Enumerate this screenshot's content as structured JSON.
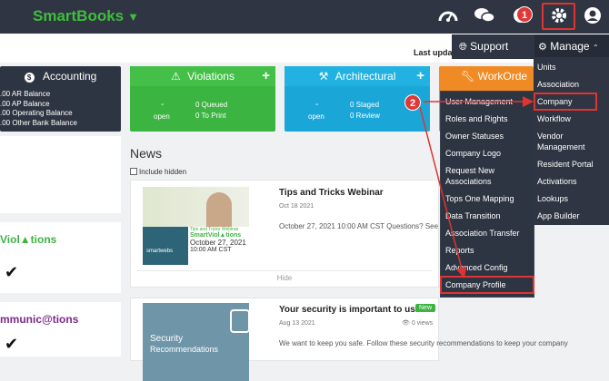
{
  "app": {
    "name": "SmartBooks"
  },
  "topbar": {
    "badge_number": "1"
  },
  "header": {
    "last_update": "Last update"
  },
  "menu": {
    "support_label": "Support",
    "manage_label": "Manage"
  },
  "cards": {
    "accounting": {
      "title": "Accounting",
      "lines": [
        ".00 AR Balance",
        ".00 AP Balance",
        ".00 Operating Balance",
        ".00 Other Bank Balance"
      ]
    },
    "violations": {
      "title": "Violations",
      "open_value": "-",
      "open_label": "open",
      "queued": "0 Queued",
      "to_print": "0 To Print"
    },
    "architectural": {
      "title": "Architectural",
      "open_value": "-",
      "open_label": "open",
      "staged": "0 Staged",
      "review": "0 Review"
    },
    "workorders": {
      "title": "WorkOrde"
    }
  },
  "left_panel": {
    "violations_brand": "Viol▲tions",
    "communications_brand": "mmunic@tions"
  },
  "news": {
    "title": "News",
    "include_hidden": "Include hidden",
    "items": [
      {
        "title": "Tips and Tricks Webinar",
        "date": "Oct 18 2021",
        "body": "October 27, 2021 10:00 AM CST Questions? See",
        "thumb_top": "Tips and Tricks Webinar",
        "thumb_brand": "SmartViol▲tions",
        "thumb_date": "October 27, 2021",
        "thumb_time": "10:00 AM CST",
        "thumb_logo": "smartwebs",
        "hide_label": "Hide"
      },
      {
        "title": "Your security is important to us.",
        "date": "Aug 13 2021",
        "body": "We want to keep you safe. Follow these security recommendations to keep your company",
        "badge": "New",
        "views": "0 views",
        "thumb_text1": "Security",
        "thumb_text2": "Recommendations"
      }
    ]
  },
  "dropdown_items": [
    "User Management",
    "Roles and Rights",
    "Owner Statuses",
    "Company Logo",
    "Request New",
    "Associations",
    "Tops One Mapping",
    "Data Transition",
    "Association Transfer",
    "Reports",
    "Advanced Config",
    "Company Profile"
  ],
  "manage_items": [
    "Units",
    "Association",
    "Company",
    "Workflow",
    "Vendor",
    "Management",
    "Resident Portal",
    "Activations",
    "Lookups",
    "App Builder"
  ],
  "annotations": {
    "step1": "1",
    "step2": "2"
  }
}
